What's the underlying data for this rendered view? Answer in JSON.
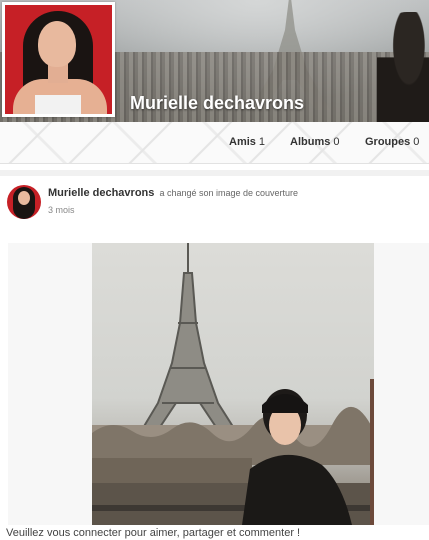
{
  "profile": {
    "name": "Murielle dechavrons"
  },
  "nav": {
    "amis_label": "Amis",
    "amis_count": "1",
    "albums_label": "Albums",
    "albums_count": "0",
    "groupes_label": "Groupes",
    "groupes_count": "0"
  },
  "post": {
    "author": "Murielle dechavrons",
    "action": "a changé son image de couverture",
    "time": "3 mois"
  },
  "footer": {
    "message": "Veuillez vous connecter pour aimer, partager et commenter !"
  },
  "colors": {
    "avatar_background": "#c62026",
    "accent_text": "#333333"
  }
}
